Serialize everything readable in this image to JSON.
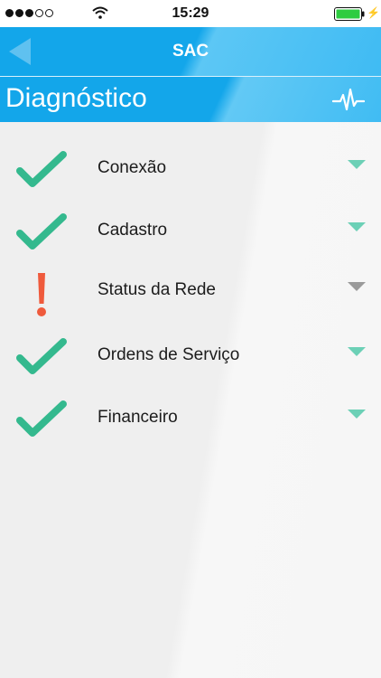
{
  "status_bar": {
    "signal_filled": 3,
    "signal_total": 5,
    "time": "15:29",
    "icons": [
      "wifi-icon",
      "battery-icon",
      "charging-bolt-icon"
    ],
    "battery_level": 1.0,
    "battery_color": "#2ecc40"
  },
  "nav": {
    "title": "SAC",
    "back_icon": "back-arrow-icon"
  },
  "section": {
    "title": "Diagnóstico",
    "icon": "heartbeat-pulse-icon"
  },
  "colors": {
    "primary": "#13a6ea",
    "check": "#34b98e",
    "warning": "#ef5a3c",
    "caret_active": "#6cd0b6",
    "caret_inactive": "#9a9a9a",
    "background": "#efefef"
  },
  "items": [
    {
      "label": "Conexão",
      "status": "ok",
      "icon": "check-icon",
      "toggle_icon": "chevron-down-icon"
    },
    {
      "label": "Cadastro",
      "status": "ok",
      "icon": "check-icon",
      "toggle_icon": "chevron-down-icon"
    },
    {
      "label": "Status da Rede",
      "status": "warning",
      "icon": "exclamation-icon",
      "toggle_icon": "chevron-down-icon"
    },
    {
      "label": "Ordens de Serviço",
      "status": "ok",
      "icon": "check-icon",
      "toggle_icon": "chevron-down-icon"
    },
    {
      "label": "Financeiro",
      "status": "ok",
      "icon": "check-icon",
      "toggle_icon": "chevron-down-icon"
    }
  ]
}
